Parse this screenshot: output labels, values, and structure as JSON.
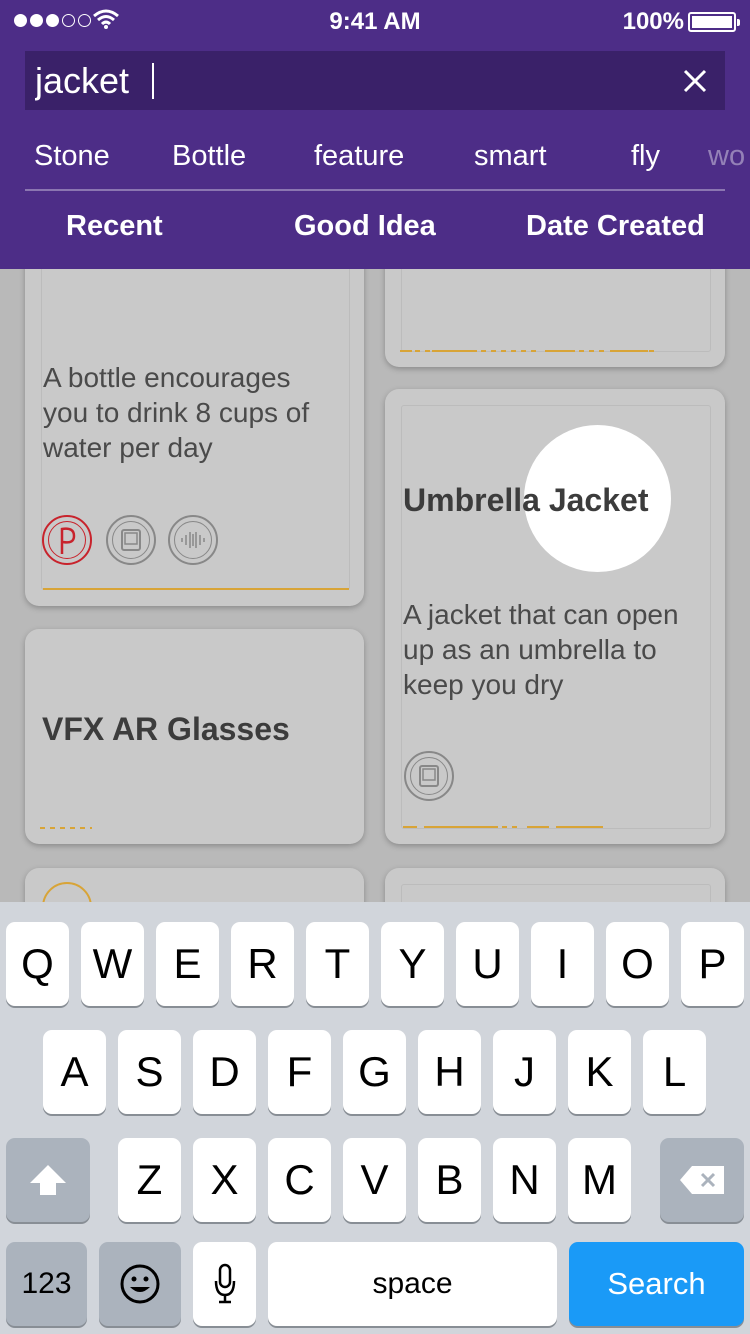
{
  "status_bar": {
    "time": "9:41 AM",
    "battery": "100%"
  },
  "search": {
    "value": "jacket"
  },
  "tags": [
    "Stone",
    "Bottle",
    "feature",
    "smart",
    "fly",
    "wo"
  ],
  "sort_options": [
    "Recent",
    "Good Idea",
    "Date Created"
  ],
  "cards": {
    "bottle": {
      "description": "A bottle encourages you to drink 8 cups of water per day"
    },
    "umbrella": {
      "title": "Umbrella Jacket",
      "description": "A jacket that can open up as an umbrella to keep you dry"
    },
    "glasses": {
      "title": "VFX AR Glasses"
    }
  },
  "keyboard": {
    "row1": [
      "Q",
      "W",
      "E",
      "R",
      "T",
      "Y",
      "U",
      "I",
      "O",
      "P"
    ],
    "row2": [
      "A",
      "S",
      "D",
      "F",
      "G",
      "H",
      "J",
      "K",
      "L"
    ],
    "row3": [
      "Z",
      "X",
      "C",
      "V",
      "B",
      "N",
      "M"
    ],
    "numbers_label": "123",
    "space_label": "space",
    "search_label": "Search"
  },
  "colors": {
    "header": "#4d2d87",
    "accent_gold": "#d8a437",
    "search_key": "#1a9af7",
    "pinterest_red": "#c8232c"
  }
}
